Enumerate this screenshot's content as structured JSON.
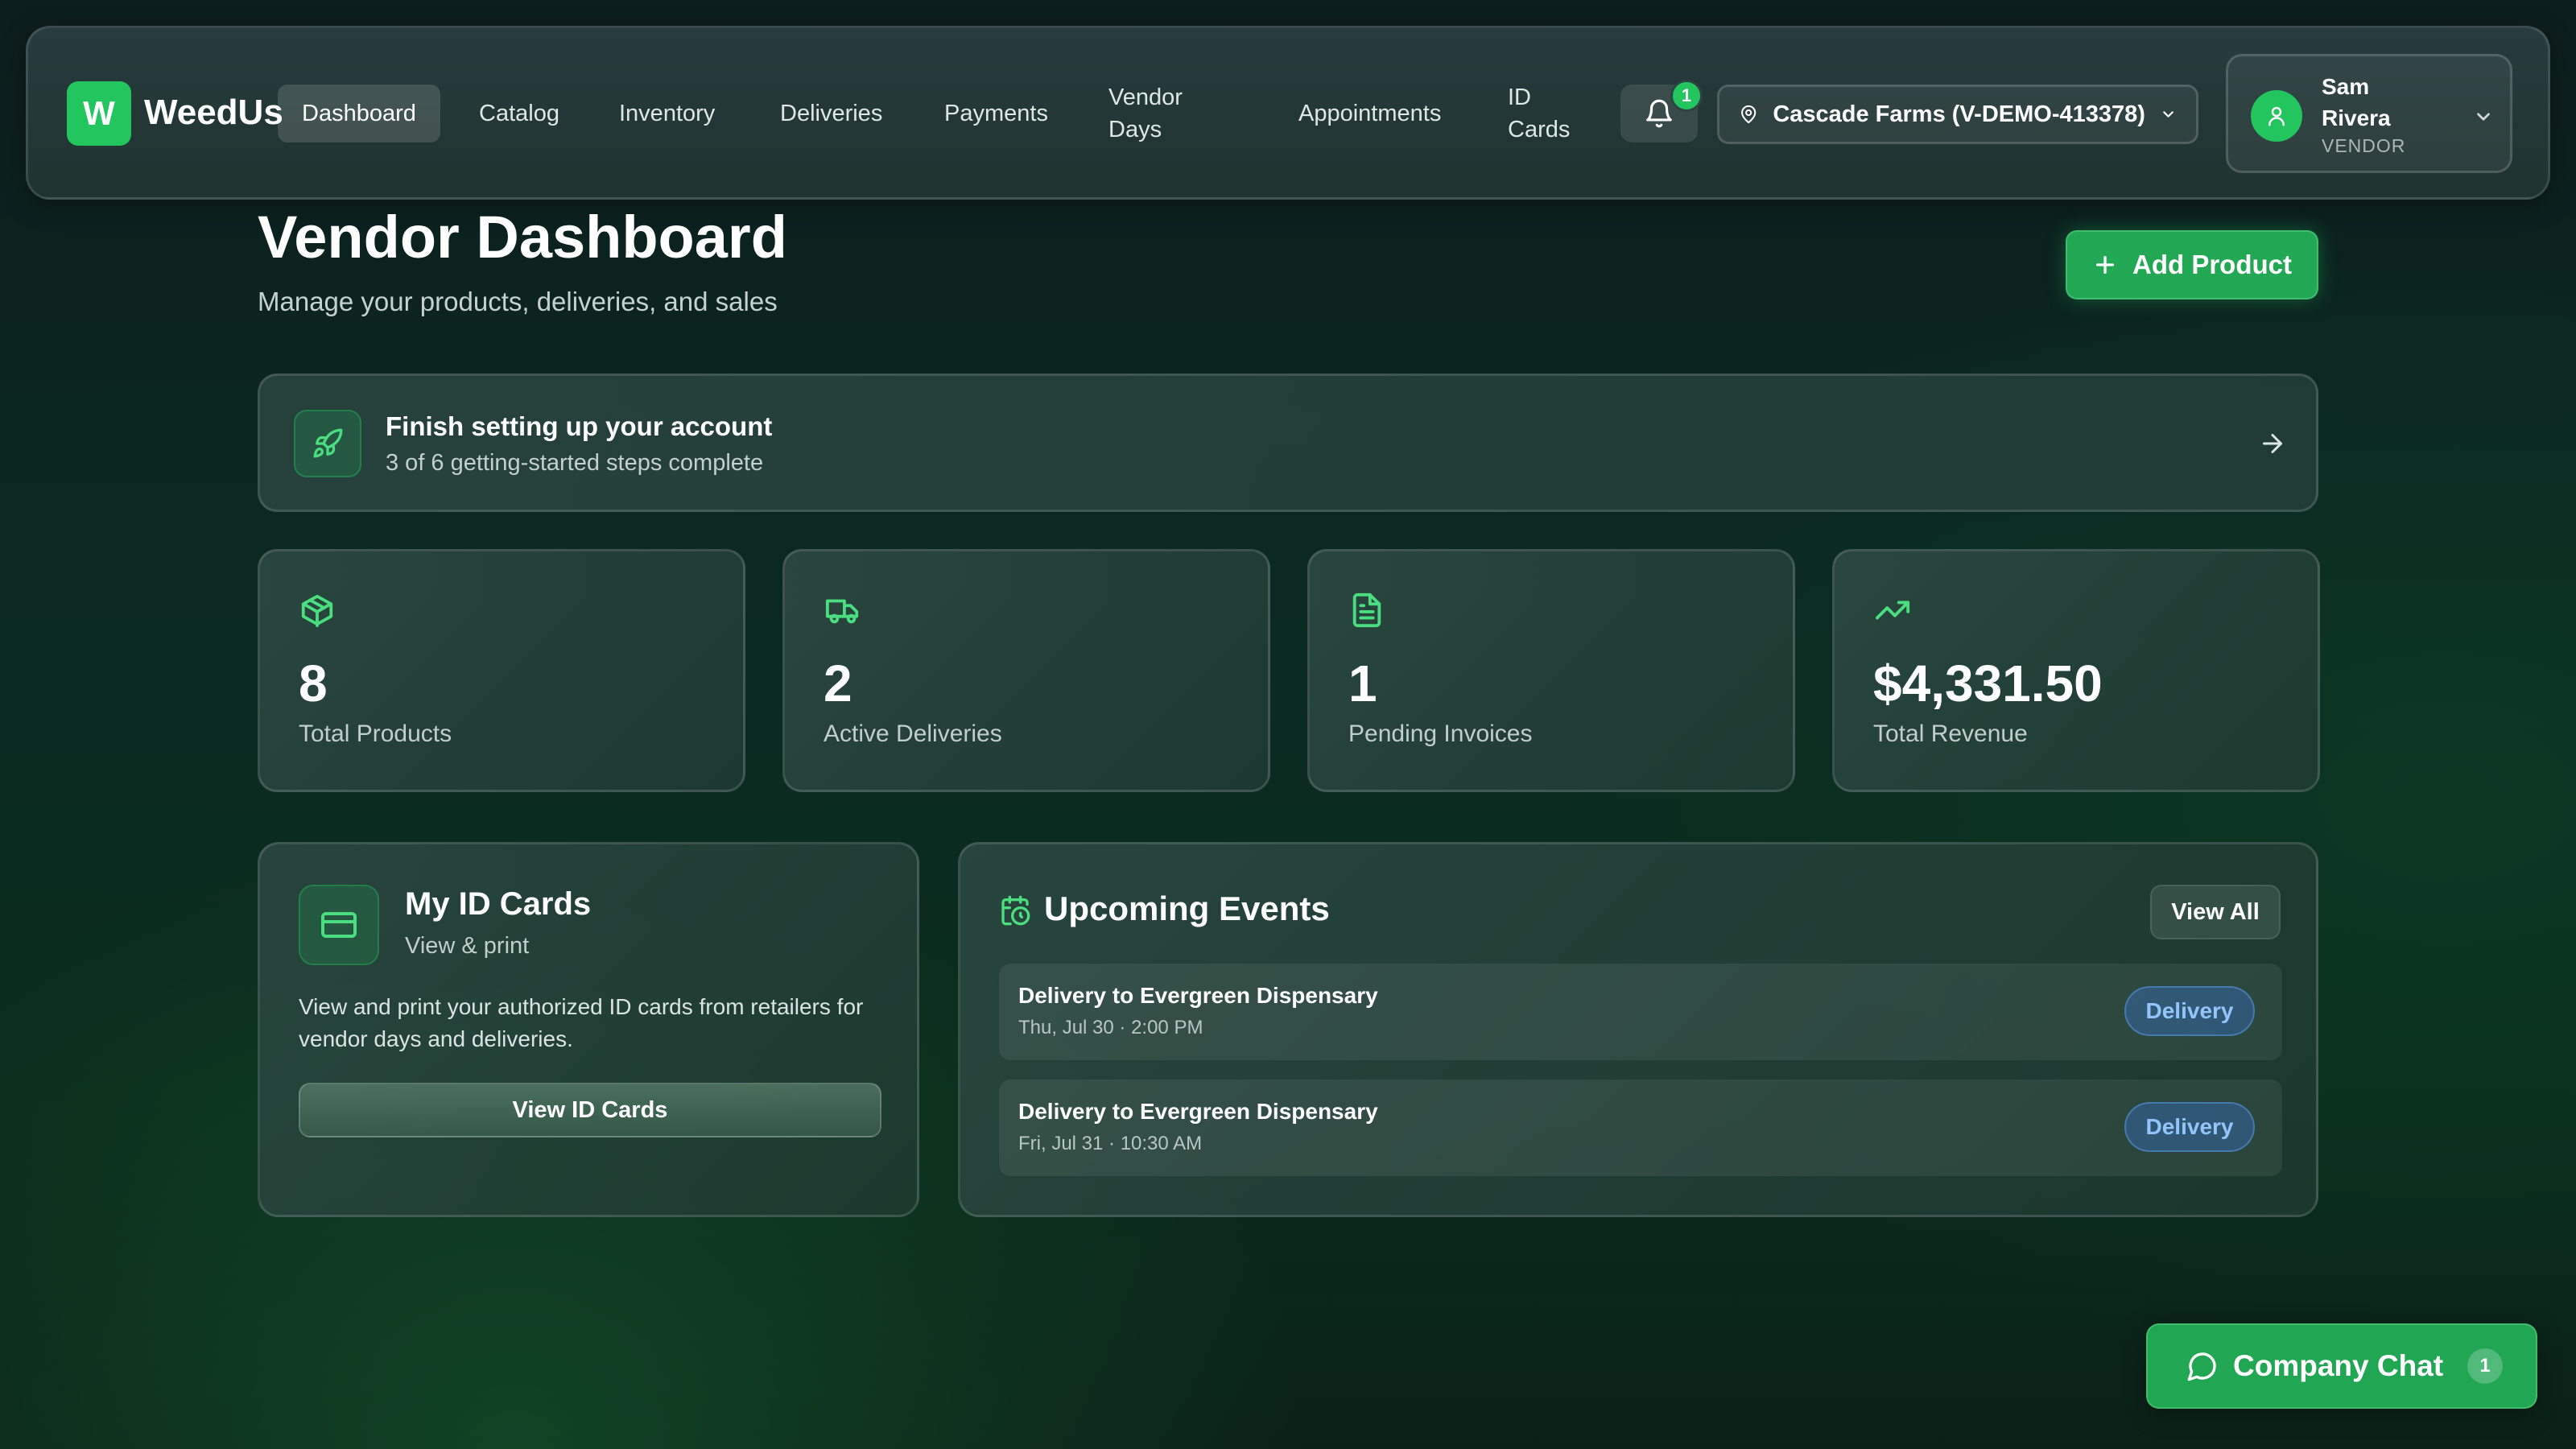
{
  "app": {
    "logo_letter": "W",
    "name": "WeedUs"
  },
  "nav": {
    "items": [
      {
        "label": "Dashboard",
        "active": true
      },
      {
        "label": "Catalog"
      },
      {
        "label": "Inventory"
      },
      {
        "label": "Deliveries"
      },
      {
        "label": "Payments"
      },
      {
        "label": "Vendor Days"
      },
      {
        "label": "Appointments"
      },
      {
        "label": "ID Cards"
      }
    ],
    "notifications_count": "1",
    "location": "Cascade Farms (V-DEMO-413378)",
    "user": {
      "name": "Sam Rivera",
      "role": "VENDOR"
    }
  },
  "header": {
    "title": "Vendor Dashboard",
    "subtitle": "Manage your products, deliveries, and sales",
    "add_product_label": "Add Product"
  },
  "setup": {
    "title": "Finish setting up your account",
    "progress_text": "3 of 6 getting-started steps complete",
    "steps_done": 3,
    "steps_total": 6
  },
  "stats": [
    {
      "value": "8",
      "label": "Total Products",
      "icon": "package-icon"
    },
    {
      "value": "2",
      "label": "Active Deliveries",
      "icon": "truck-icon"
    },
    {
      "value": "1",
      "label": "Pending Invoices",
      "icon": "file-text-icon"
    },
    {
      "value": "$4,331.50",
      "label": "Total Revenue",
      "icon": "trending-up-icon"
    }
  ],
  "id_cards": {
    "title": "My ID Cards",
    "subtitle": "View & print",
    "description": "View and print your authorized ID cards from retailers for vendor days and deliveries.",
    "button_label": "View ID Cards"
  },
  "events": {
    "title": "Upcoming Events",
    "view_all_label": "View All",
    "items": [
      {
        "title": "Delivery to Evergreen Dispensary",
        "time": "Thu, Jul 30 · 2:00 PM",
        "badge": "Delivery"
      },
      {
        "title": "Delivery to Evergreen Dispensary",
        "time": "Fri, Jul 31 · 10:30 AM",
        "badge": "Delivery"
      }
    ]
  },
  "chat": {
    "label": "Company Chat",
    "unread": "1"
  },
  "colors": {
    "accent": "#22c55e",
    "badge_blue": "#93c5fd",
    "background": "#0b2a22"
  }
}
